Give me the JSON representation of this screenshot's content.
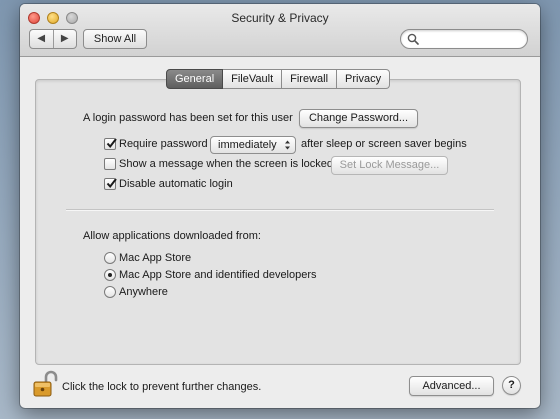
{
  "window": {
    "title": "Security & Privacy",
    "nav_back": "◀",
    "nav_forward": "▶",
    "show_all_label": "Show All",
    "search_placeholder": ""
  },
  "tabs": [
    {
      "label": "General",
      "active": true
    },
    {
      "label": "FileVault",
      "active": false
    },
    {
      "label": "Firewall",
      "active": false
    },
    {
      "label": "Privacy",
      "active": false
    }
  ],
  "general": {
    "login_password_text": "A login password has been set for this user",
    "change_password_label": "Change Password...",
    "require_password": {
      "label": "Require password",
      "checked": true
    },
    "require_delay": {
      "selected": "immediately"
    },
    "after_sleep_text": "after sleep or screen saver begins",
    "show_message": {
      "label": "Show a message when the screen is locked",
      "checked": false
    },
    "set_lock_message_label": "Set Lock Message...",
    "disable_auto_login": {
      "label": "Disable automatic login",
      "checked": true
    }
  },
  "downloads": {
    "heading": "Allow applications downloaded from:",
    "options": [
      {
        "label": "Mac App Store",
        "selected": false
      },
      {
        "label": "Mac App Store and identified developers",
        "selected": true
      },
      {
        "label": "Anywhere",
        "selected": false
      }
    ]
  },
  "footer": {
    "lock_text": "Click the lock to prevent further changes.",
    "advanced_label": "Advanced...",
    "help_label": "?"
  },
  "colors": {
    "active_tab": "#5e5e5e",
    "lock_gold": "#d99a2b",
    "desktop": "#8da2b8"
  }
}
